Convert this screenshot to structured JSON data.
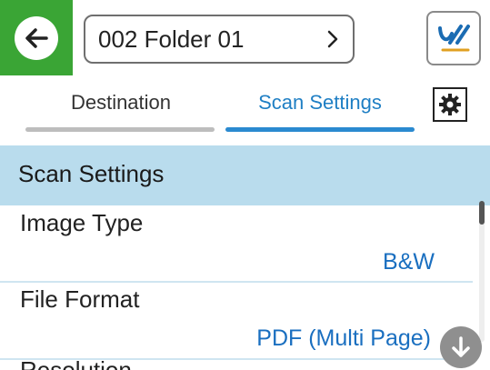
{
  "header": {
    "back_icon": "back-arrow-icon",
    "folder_name": "002 Folder 01",
    "folder_chevron_icon": "chevron-right-icon",
    "logo_icon": "epson-scan-logo-icon",
    "accent_color": "#3aa535"
  },
  "tabs": [
    {
      "label": "Destination",
      "active": false
    },
    {
      "label": "Scan Settings",
      "active": true
    }
  ],
  "gear_icon": "gear-icon",
  "section": {
    "title": "Scan Settings",
    "background_color": "#b9dced"
  },
  "settings": [
    {
      "label": "Image Type",
      "value": "B&W"
    },
    {
      "label": "File Format",
      "value": "PDF (Multi Page)"
    },
    {
      "label": "Resolution"
    }
  ],
  "scroll_down_icon": "arrow-down-icon",
  "value_color": "#1a6fc0"
}
